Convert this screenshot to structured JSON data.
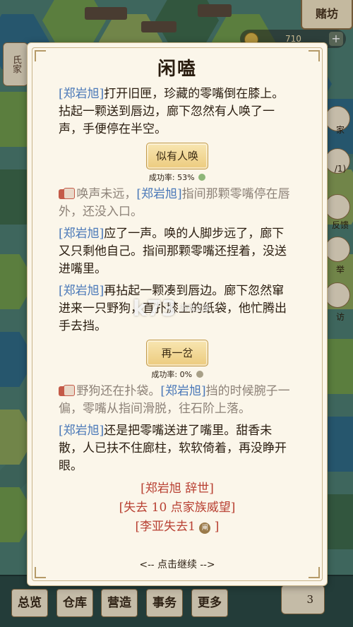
{
  "background": {
    "top_right_label": "赌坊",
    "currency_value": "710",
    "left_side_label": "氏家",
    "right_labels": [
      "家",
      "/1)",
      "反馈",
      "举",
      "访"
    ]
  },
  "dialog": {
    "title": "闲嗑",
    "paragraphs": [
      {
        "style": "normal",
        "name": "[郑岩旭]",
        "text": "打开旧匣，珍藏的零嘴倒在膝上。拈起一颗送到唇边，廊下忽然有人唤了一声，手便停在半空。"
      }
    ],
    "choice1": {
      "label": "似有人唤",
      "rate_label": "成功率:",
      "rate_value": "53%"
    },
    "paragraphs2": [
      {
        "style": "dim",
        "dice": true,
        "prefix": "唤声未远，",
        "name": "[郑岩旭]",
        "text": "指间那颗零嘴停在唇外，还没入口。"
      },
      {
        "style": "normal",
        "name": "[郑岩旭]",
        "text": "应了一声。唤的人脚步远了，廊下又只剩他自己。指间那颗零嘴还捏着，没送进嘴里。"
      },
      {
        "style": "normal",
        "name": "[郑岩旭]",
        "text": "再拈起一颗凑到唇边。廊下忽然窜进来一只野狗，直扑膝上的纸袋，他忙腾出手去挡。"
      }
    ],
    "choice2": {
      "label": "再一岔",
      "rate_label": "成功率:",
      "rate_value": "0%"
    },
    "paragraphs3": [
      {
        "style": "dim",
        "dice": true,
        "prefix": "野狗还在扑袋。",
        "name": "[郑岩旭]",
        "text": "挡的时候腕子一偏，零嘴从指间滑脱，往石阶上落。"
      },
      {
        "style": "normal",
        "name": "[郑岩旭]",
        "text": "还是把零嘴送进了嘴里。甜香未散，人已扶不住廊柱，软软倚着，再没睁开眼。"
      }
    ],
    "results": [
      "[郑岩旭 辞世]",
      "[失去 10 点家族威望]",
      "[李亚失去1",
      " ]"
    ],
    "badge_text": "阐",
    "continue_text": "<-- 点击继续 -->"
  },
  "bottom_tabs": [
    "总览",
    "仓库",
    "营造",
    "事务",
    "更多"
  ],
  "energy_value": "3",
  "watermark": {
    "main": "k73",
    "sub": "游戏之家"
  }
}
